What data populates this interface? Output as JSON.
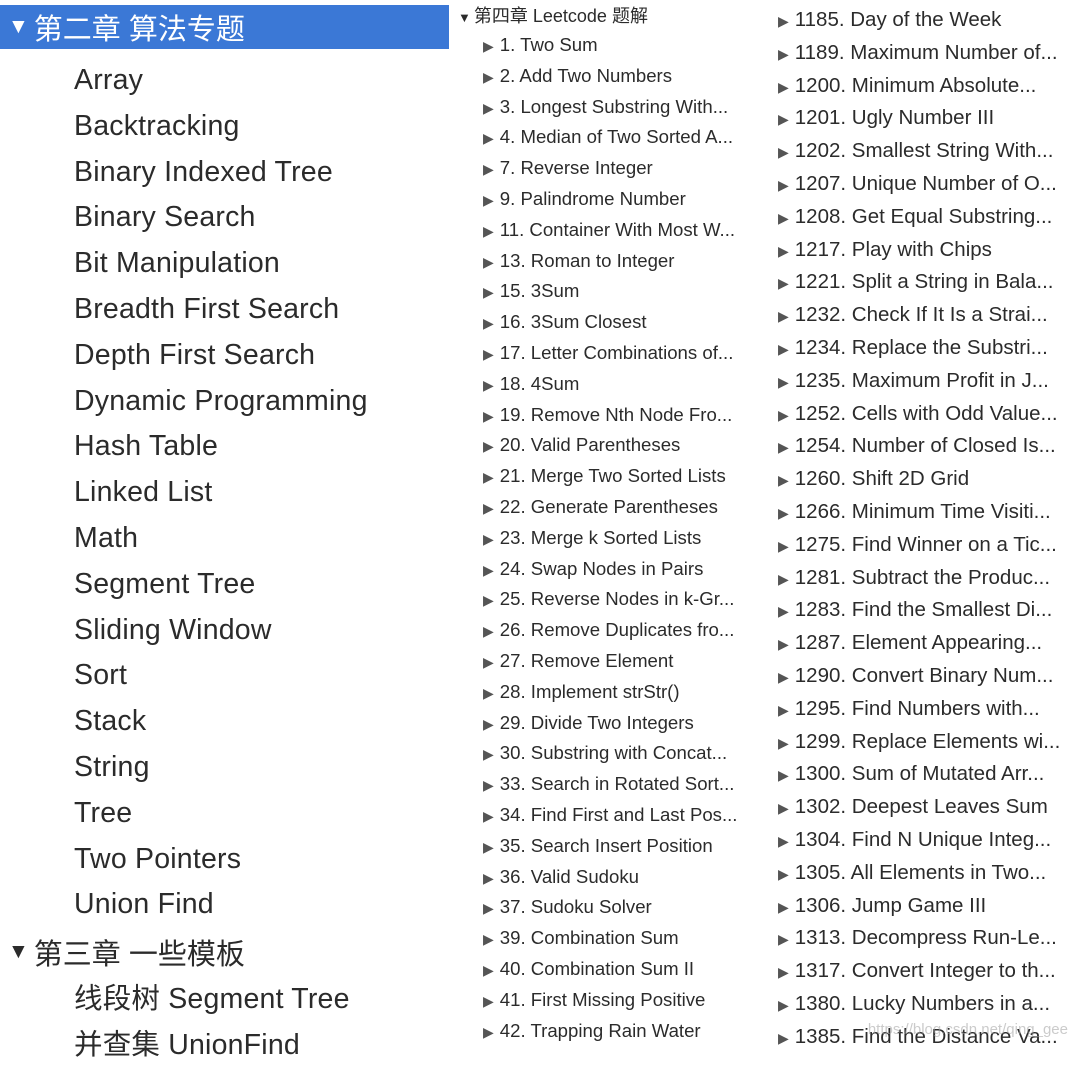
{
  "ch2": {
    "title": "第二章 算法专题",
    "items": [
      "Array",
      "Backtracking",
      "Binary Indexed Tree",
      "Binary Search",
      "Bit Manipulation",
      "Breadth First Search",
      "Depth First Search",
      "Dynamic Programming",
      "Hash Table",
      "Linked List",
      "Math",
      "Segment Tree",
      "Sliding Window",
      "Sort",
      "Stack",
      "String",
      "Tree",
      "Two Pointers",
      "Union Find"
    ]
  },
  "ch3": {
    "title": "第三章 一些模板",
    "items": [
      "线段树 Segment Tree",
      "并查集 UnionFind"
    ]
  },
  "ch4": {
    "title": "第四章 Leetcode 题解",
    "items_left": [
      "1. Two Sum",
      "2. Add Two Numbers",
      "3. Longest Substring With...",
      "4. Median of Two Sorted A...",
      "7. Reverse Integer",
      "9. Palindrome Number",
      "11. Container With Most W...",
      "13. Roman to Integer",
      "15. 3Sum",
      "16. 3Sum Closest",
      "17. Letter Combinations of...",
      "18. 4Sum",
      "19. Remove Nth Node Fro...",
      "20. Valid Parentheses",
      "21. Merge Two Sorted Lists",
      "22. Generate Parentheses",
      "23. Merge k Sorted Lists",
      "24. Swap Nodes in Pairs",
      "25. Reverse Nodes in k-Gr...",
      "26. Remove Duplicates fro...",
      "27. Remove Element",
      "28. Implement strStr()",
      "29. Divide Two Integers",
      "30. Substring with Concat...",
      "33. Search in Rotated Sort...",
      "34. Find First and Last Pos...",
      "35. Search Insert Position",
      "36. Valid Sudoku",
      "37. Sudoku Solver",
      "39. Combination Sum",
      "40. Combination Sum II",
      "41. First Missing Positive",
      "42. Trapping Rain Water"
    ],
    "items_right": [
      "1185. Day of the Week",
      "1189. Maximum Number of...",
      "1200. Minimum Absolute...",
      "1201. Ugly Number III",
      "1202. Smallest String With...",
      "1207. Unique Number of O...",
      "1208. Get Equal Substring...",
      "1217. Play with Chips",
      "1221. Split a String in Bala...",
      "1232. Check If It Is a Strai...",
      "1234. Replace the Substri...",
      "1235. Maximum Profit in J...",
      "1252. Cells with Odd Value...",
      "1254. Number of Closed Is...",
      "1260. Shift 2D Grid",
      "1266. Minimum Time Visiti...",
      "1275. Find Winner on a Tic...",
      "1281. Subtract the Produc...",
      "1283. Find the Smallest Di...",
      "1287. Element Appearing...",
      "1290. Convert Binary Num...",
      "1295. Find Numbers with...",
      "1299. Replace Elements wi...",
      "1300. Sum of Mutated Arr...",
      "1302. Deepest Leaves Sum",
      "1304. Find N Unique Integ...",
      "1305. All Elements in Two...",
      "1306. Jump Game III",
      "1313. Decompress Run-Le...",
      "1317. Convert Integer to th...",
      "1380. Lucky Numbers in a...",
      "1385. Find the Distance Va..."
    ]
  },
  "glyphs": {
    "expanded": "▼",
    "collapsed": "▶"
  },
  "watermark": "https://blog.csdn.net/qing_gee",
  "colors": {
    "selection": "#3b78d6",
    "text": "#2b2b2b"
  }
}
